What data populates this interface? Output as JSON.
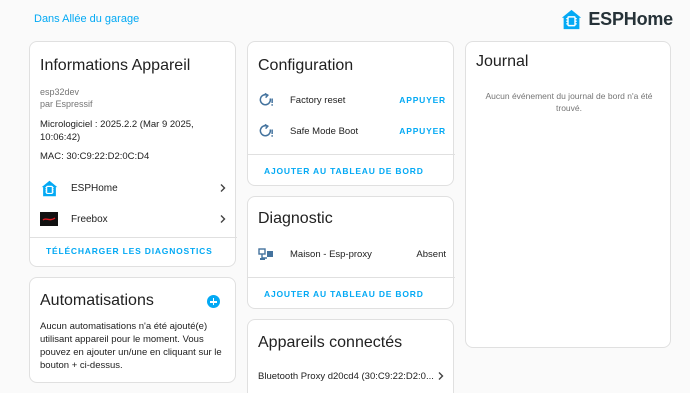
{
  "breadcrumb": "Dans Allée du garage",
  "brand": {
    "name": "ESPHome",
    "color": "#03a9f4"
  },
  "device_card": {
    "title": "Informations Appareil",
    "model": "esp32dev",
    "manufacturer": "par Espressif",
    "firmware": "Micrologiciel : 2025.2.2 (Mar 9 2025, 10:06:42)",
    "mac": "MAC: 30:C9:22:D2:0C:D4",
    "integrations": [
      {
        "label": "ESPHome",
        "icon": "esphome-icon"
      },
      {
        "label": "Freebox",
        "icon": "freebox-icon"
      }
    ],
    "download_diagnostics": "TÉLÉCHARGER LES DIAGNOSTICS"
  },
  "automations_card": {
    "title": "Automatisations",
    "empty_text": "Aucun automatisations n'a été ajouté(e) utilisant appareil pour le moment. Vous pouvez en ajouter un/une en cliquant sur le bouton + ci-dessus."
  },
  "config_card": {
    "title": "Configuration",
    "entities": [
      {
        "label": "Factory reset",
        "action": "APPUYER",
        "icon": "restart-alert-icon"
      },
      {
        "label": "Safe Mode Boot",
        "action": "APPUYER",
        "icon": "restart-alert-icon"
      }
    ],
    "add_to_dashboard": "AJOUTER AU TABLEAU DE BORD"
  },
  "diagnostic_card": {
    "title": "Diagnostic",
    "entities": [
      {
        "label": "Maison - Esp-proxy",
        "value": "Absent",
        "icon": "lan-connect-icon"
      }
    ],
    "add_to_dashboard": "AJOUTER AU TABLEAU DE BORD"
  },
  "connected_card": {
    "title": "Appareils connectés",
    "devices": [
      {
        "label": "Bluetooth Proxy d20cd4 (30:C9:22:D2:0..."
      }
    ]
  },
  "journal_card": {
    "title": "Journal",
    "empty_text": "Aucun événement du journal de bord n'a été trouvé."
  }
}
